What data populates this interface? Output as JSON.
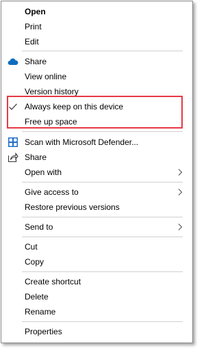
{
  "menu": {
    "open": "Open",
    "print": "Print",
    "edit": "Edit",
    "onedrive_share": "Share",
    "view_online": "View online",
    "version_history": "Version history",
    "always_keep": "Always keep on this device",
    "free_up_space": "Free up space",
    "scan_defender": "Scan with Microsoft Defender...",
    "share": "Share",
    "open_with": "Open with",
    "give_access": "Give access to",
    "restore_versions": "Restore previous versions",
    "send_to": "Send to",
    "cut": "Cut",
    "copy": "Copy",
    "create_shortcut": "Create shortcut",
    "delete": "Delete",
    "rename": "Rename",
    "properties": "Properties"
  },
  "icons": {
    "onedrive": "cloud-icon",
    "always_keep_check": "checkmark-icon",
    "defender": "shield-icon",
    "share": "share-icon"
  },
  "colors": {
    "highlight_border": "#e53945",
    "onedrive_blue": "#0f6cbd",
    "defender_blue": "#1f6fc5"
  }
}
